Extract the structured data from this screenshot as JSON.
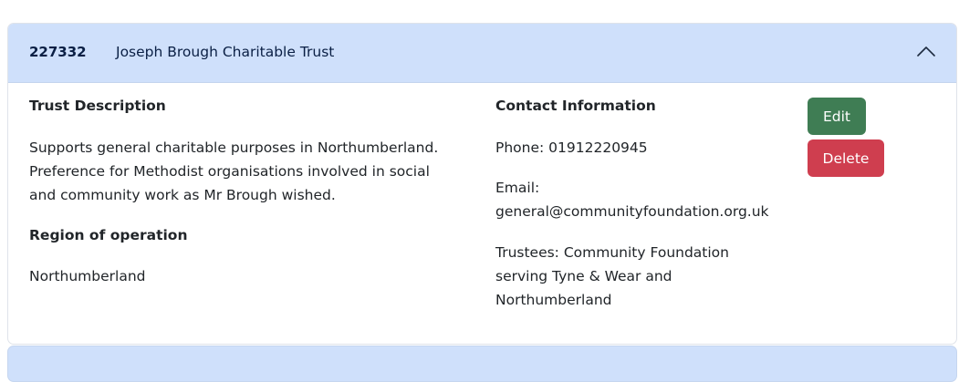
{
  "trust": {
    "id": "227332",
    "name": "Joseph Brough Charitable Trust",
    "expanded": true
  },
  "description": {
    "heading": "Trust Description",
    "lines": [
      "Supports general charitable purposes in Northumberland.",
      "Preference for Methodist organisations involved in social",
      "and community work as Mr Brough wished."
    ]
  },
  "region": {
    "heading": "Region of operation",
    "value": "Northumberland"
  },
  "contact": {
    "heading": "Contact Information",
    "phone": "Phone: 01912220945",
    "email_label": "Email:",
    "email_value": "general@communityfoundation.org.uk",
    "trustees_lines": [
      "Trustees: Community Foundation",
      "serving Tyne & Wear and",
      "Northumberland"
    ]
  },
  "actions": {
    "edit_label": "Edit",
    "delete_label": "Delete"
  },
  "icons": {
    "toggle": "chevron-up-icon"
  },
  "colors": {
    "header_bg": "#cfe0fb",
    "edit_bg": "#3f7d54",
    "delete_bg": "#cf3e4f",
    "header_text": "#0a1f44"
  }
}
